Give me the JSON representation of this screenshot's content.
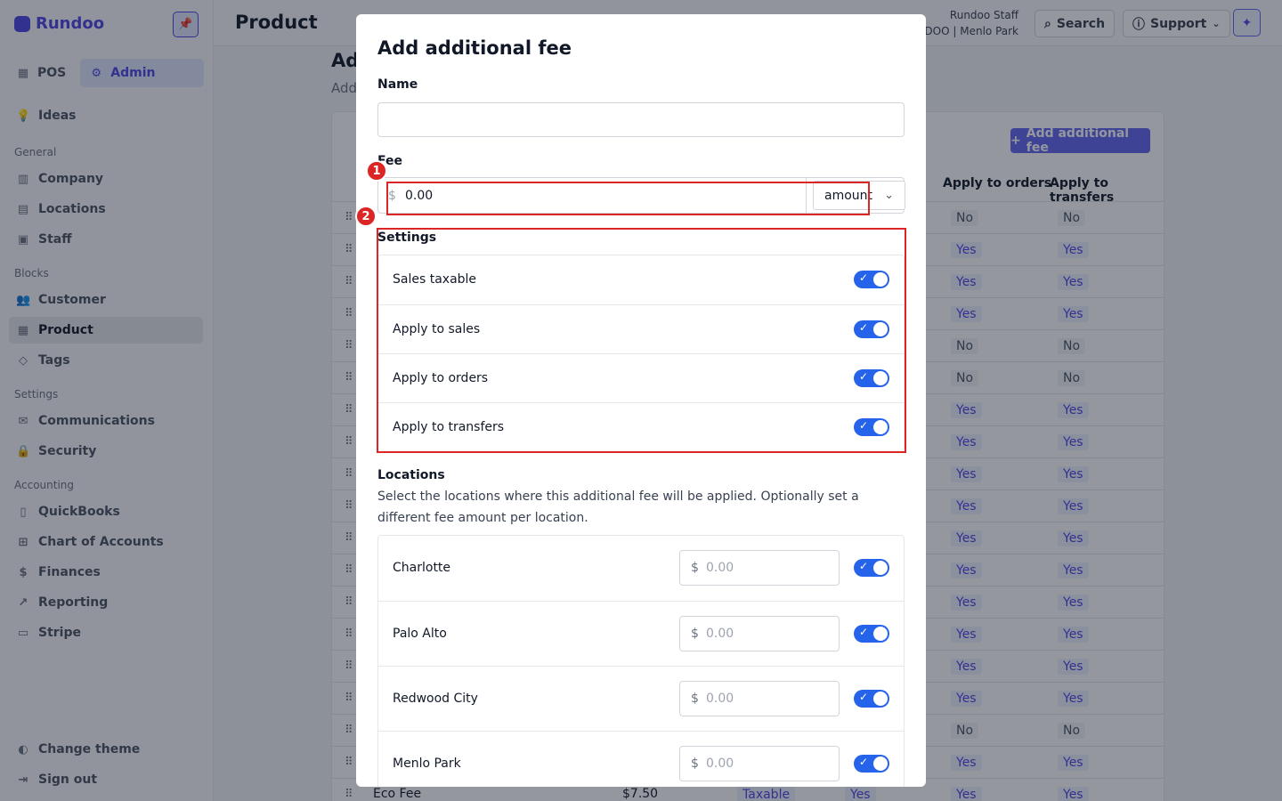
{
  "brand": {
    "name": "Rundoo"
  },
  "sidebar": {
    "modes": [
      {
        "label": "POS",
        "icon": "store-icon"
      },
      {
        "label": "Admin",
        "icon": "gear-icon"
      }
    ],
    "ideas": {
      "label": "Ideas",
      "icon": "lightbulb-icon"
    },
    "sections": [
      {
        "heading": "General",
        "items": [
          {
            "label": "Company",
            "icon": "building-icon"
          },
          {
            "label": "Locations",
            "icon": "office-icon"
          },
          {
            "label": "Staff",
            "icon": "badge-icon"
          }
        ]
      },
      {
        "heading": "Blocks",
        "items": [
          {
            "label": "Customer",
            "icon": "users-icon"
          },
          {
            "label": "Product",
            "icon": "grid-icon"
          },
          {
            "label": "Tags",
            "icon": "tag-icon"
          }
        ]
      },
      {
        "heading": "Settings",
        "items": [
          {
            "label": "Communications",
            "icon": "mail-icon"
          },
          {
            "label": "Security",
            "icon": "lock-icon"
          }
        ]
      },
      {
        "heading": "Accounting",
        "items": [
          {
            "label": "QuickBooks",
            "icon": "book-icon"
          },
          {
            "label": "Chart of Accounts",
            "icon": "table-icon"
          },
          {
            "label": "Finances",
            "icon": "dollar-icon"
          },
          {
            "label": "Reporting",
            "icon": "chart-icon"
          },
          {
            "label": "Stripe",
            "icon": "card-icon"
          }
        ]
      }
    ],
    "footer": [
      {
        "label": "Change theme",
        "icon": "theme-icon"
      },
      {
        "label": "Sign out",
        "icon": "signout-icon"
      }
    ]
  },
  "topbar": {
    "title": "Product",
    "user_name": "Rundoo Staff",
    "user_org": "NDOO | Menlo Park",
    "search_label": "Search",
    "support_label": "Support"
  },
  "background": {
    "title": "Ad",
    "subtitle": "Add",
    "add_button": "Add additional fee",
    "headers": [
      "Apply to orders",
      "Apply to transfers"
    ],
    "rows": [
      [
        "No",
        "No"
      ],
      [
        "Yes",
        "Yes"
      ],
      [
        "Yes",
        "Yes"
      ],
      [
        "Yes",
        "Yes"
      ],
      [
        "No",
        "No"
      ],
      [
        "No",
        "No"
      ],
      [
        "Yes",
        "Yes"
      ],
      [
        "Yes",
        "Yes"
      ],
      [
        "Yes",
        "Yes"
      ],
      [
        "Yes",
        "Yes"
      ],
      [
        "Yes",
        "Yes"
      ],
      [
        "Yes",
        "Yes"
      ],
      [
        "Yes",
        "Yes"
      ],
      [
        "Yes",
        "Yes"
      ],
      [
        "Yes",
        "Yes"
      ],
      [
        "Yes",
        "Yes"
      ],
      [
        "No",
        "No"
      ],
      [
        "Yes",
        "Yes"
      ]
    ],
    "last_row": {
      "name": "Eco Fee",
      "price": "$7.50",
      "tax": "Taxable",
      "sales": "Yes",
      "orders": "Yes",
      "transfers": "Yes"
    }
  },
  "modal": {
    "title": "Add additional fee",
    "name_label": "Name",
    "name_value": "",
    "fee_label": "Fee",
    "fee_prefix": "$",
    "fee_value": "0.00",
    "fee_type": "amount",
    "settings_label": "Settings",
    "settings": [
      {
        "label": "Sales taxable",
        "on": true
      },
      {
        "label": "Apply to sales",
        "on": true
      },
      {
        "label": "Apply to orders",
        "on": true
      },
      {
        "label": "Apply to transfers",
        "on": true
      }
    ],
    "locations_label": "Locations",
    "locations_desc": "Select the locations where this additional fee will be applied. Optionally set a different fee amount per location.",
    "locations": [
      {
        "name": "Charlotte",
        "prefix": "$",
        "placeholder": "0.00",
        "on": true
      },
      {
        "name": "Palo Alto",
        "prefix": "$",
        "placeholder": "0.00",
        "on": true
      },
      {
        "name": "Redwood City",
        "prefix": "$",
        "placeholder": "0.00",
        "on": true
      },
      {
        "name": "Menlo Park",
        "prefix": "$",
        "placeholder": "0.00",
        "on": true
      }
    ]
  },
  "annotations": {
    "marker_1": "1",
    "marker_2": "2",
    "color": "#dc2626"
  }
}
